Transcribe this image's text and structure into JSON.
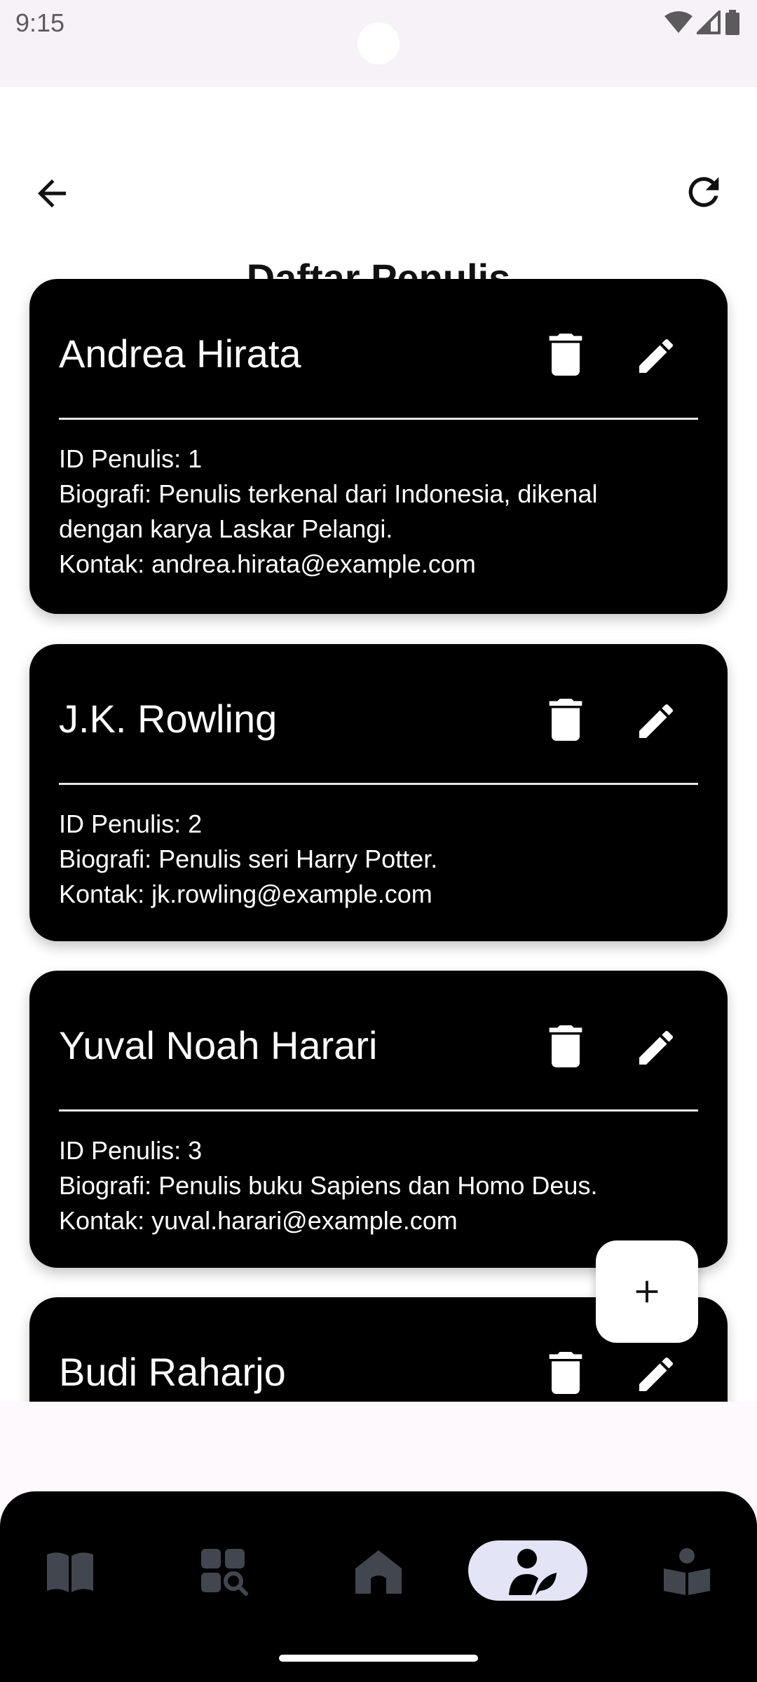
{
  "status_bar": {
    "time": "9:15",
    "icons": [
      "wifi-icon",
      "signal-icon",
      "battery-icon"
    ]
  },
  "app_bar": {
    "title": "Daftar Penulis",
    "back_icon": "arrow-left-icon",
    "refresh_icon": "refresh-icon"
  },
  "writers": [
    {
      "name": "Andrea Hirata",
      "id_line": "ID Penulis: 1",
      "bio_line": "Biografi: Penulis terkenal dari Indonesia, dikenal dengan karya Laskar Pelangi.",
      "contact_line": "Kontak: andrea.hirata@example.com"
    },
    {
      "name": "J.K. Rowling",
      "id_line": "ID Penulis: 2",
      "bio_line": "Biografi: Penulis seri Harry Potter.",
      "contact_line": "Kontak: jk.rowling@example.com"
    },
    {
      "name": "Yuval Noah Harari",
      "id_line": "ID Penulis: 3",
      "bio_line": "Biografi: Penulis buku Sapiens dan Homo Deus.",
      "contact_line": "Kontak: yuval.harari@example.com"
    },
    {
      "name": "Budi Raharjo",
      "id_line": "",
      "bio_line": "",
      "contact_line": ""
    }
  ],
  "fab": {
    "icon": "plus-icon"
  },
  "bottom_nav": {
    "items": [
      {
        "icon": "book-icon",
        "active": false
      },
      {
        "icon": "category-search-icon",
        "active": false
      },
      {
        "icon": "home-icon",
        "active": false
      },
      {
        "icon": "writer-icon",
        "active": true
      },
      {
        "icon": "reader-icon",
        "active": false
      }
    ]
  },
  "colors": {
    "card_background": "#000000",
    "nav_active_pill": "#e3e4f6",
    "nav_inactive_icon": "#42464f"
  }
}
